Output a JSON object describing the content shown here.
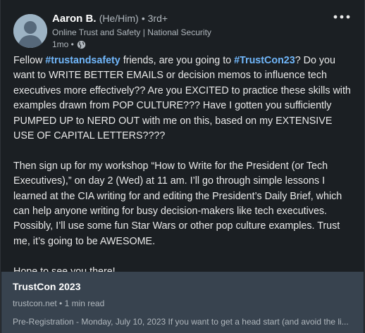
{
  "post": {
    "author": {
      "name": "Aaron B.",
      "pronouns": "(He/Him)",
      "degree": "• 3rd+",
      "headline": "Online Trust and Safety | National Security",
      "time": "1mo •",
      "visibility_icon": "globe-icon"
    },
    "menu_icon": "more-horizontal-icon",
    "body": {
      "p1_prefix": "Fellow ",
      "hashtag1": "#trustandsafety",
      "p1_mid": " friends, are you going to ",
      "hashtag2": "#TrustCon23",
      "p1_suffix": "? Do you want to WRITE BETTER EMAILS or decision memos to influence tech executives more effectively?? Are you EXCITED to practice these skills with examples drawn from POP CULTURE??? Have I gotten you sufficiently PUMPED UP to NERD OUT with me on this, based on my EXTENSIVE USE OF CAPITAL LETTERS????",
      "p2": "Then sign up for my workshop “How to Write for the President (or Tech Executives),” on day 2 (Wed) at 11 am. I’ll go through simple lessons I learned at the CIA writing for and editing the President’s Daily Brief, which can help anyone writing for busy decision-makers like tech executives. Possibly, I’ll use some fun Star Wars or other pop culture examples. Trust me, it’s going to be AWESOME.",
      "p3": "Hope to see you there!"
    },
    "link_card": {
      "title": "TrustCon 2023",
      "meta": "trustcon.net • 1 min read",
      "snippet": "Pre-Registration - Monday, July 10, 2023 If you want to get a head start (and avoid the li..."
    }
  },
  "colors": {
    "background": "#1b1f23",
    "hashtag": "#71b7fb",
    "card_background": "#38434f"
  }
}
